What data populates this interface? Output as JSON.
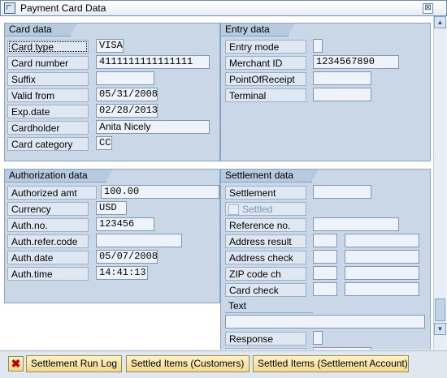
{
  "window": {
    "title": "Payment Card Data",
    "close_glyph": "⊠"
  },
  "card_data": {
    "heading": "Card data",
    "card_type_label": "Card type",
    "card_type": "VISA",
    "card_number_label": "Card number",
    "card_number": "4111111111111111",
    "suffix_label": "Suffix",
    "suffix": "",
    "valid_from_label": "Valid from",
    "valid_from": "05/31/2008",
    "exp_date_label": "Exp.date",
    "exp_date": "02/28/2013",
    "cardholder_label": "Cardholder",
    "cardholder": "Anita Nicely",
    "card_category_label": "Card category",
    "card_category": "CC"
  },
  "entry_data": {
    "heading": "Entry data",
    "entry_mode_label": "Entry mode",
    "entry_mode": "",
    "merchant_id_label": "Merchant ID",
    "merchant_id": "1234567890",
    "point_of_receipt_label": "PointOfReceipt",
    "point_of_receipt": "",
    "terminal_label": "Terminal",
    "terminal": ""
  },
  "authorization_data": {
    "heading": "Authorization data",
    "authorized_amt_label": "Authorized amt",
    "authorized_amt": "100.00",
    "currency_label": "Currency",
    "currency": "USD",
    "auth_no_label": "Auth.no.",
    "auth_no": "123456",
    "auth_refer_code_label": "Auth.refer.code",
    "auth_refer_code": "",
    "auth_date_label": "Auth.date",
    "auth_date": "05/07/2008",
    "auth_time_label": "Auth.time",
    "auth_time": "14:41:13"
  },
  "settlement_data": {
    "heading": "Settlement data",
    "settlement_label": "Settlement",
    "settlement": "",
    "settled_label": "Settled",
    "settled_checked": false,
    "reference_no_label": "Reference no.",
    "reference_no": "",
    "address_result_label": "Address result",
    "address_check_label": "Address check",
    "zip_code_ch_label": "ZIP code ch",
    "card_check_label": "Card check",
    "text_label": "Text",
    "response_label": "Response"
  },
  "footer": {
    "cancel_glyph": "✖",
    "settlement_run_log": "Settlement Run Log",
    "settled_items_customers": "Settled Items (Customers)",
    "settled_items_settlement_account": "Settled Items (Settlement Account)"
  },
  "colors": {
    "panel": "#c9d7e6",
    "button": "#f2d890",
    "cancel": "#c00000"
  }
}
